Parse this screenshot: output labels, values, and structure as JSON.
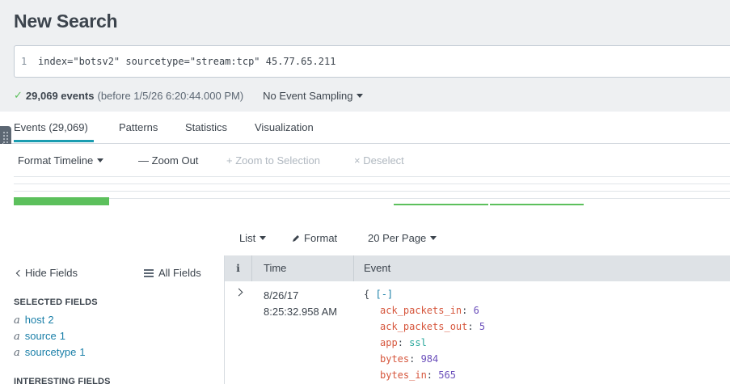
{
  "page": {
    "title": "New Search"
  },
  "search": {
    "line_number": "1",
    "query": "index=\"botsv2\" sourcetype=\"stream:tcp\" 45.77.65.211"
  },
  "status": {
    "check": "✓",
    "count": "29,069 events",
    "detail": "(before 1/5/26 6:20:44.000 PM)",
    "sampling": "No Event Sampling"
  },
  "tabs": [
    {
      "label": "Events (29,069)",
      "active": true
    },
    {
      "label": "Patterns"
    },
    {
      "label": "Statistics"
    },
    {
      "label": "Visualization"
    }
  ],
  "timeline": {
    "format": "Format Timeline",
    "zoom_out": "Zoom Out",
    "zoom_selection": "Zoom to Selection",
    "deselect": "Deselect",
    "zoom_out_glyph": "—",
    "zoom_sel_glyph": "+",
    "deselect_glyph": "×",
    "bar_color": "#5cc05c"
  },
  "results_toolbar": {
    "list": "List",
    "format": "Format",
    "per_page": "20 Per Page"
  },
  "fields": {
    "hide": "Hide Fields",
    "all": "All Fields",
    "selected_title": "SELECTED FIELDS",
    "selected": [
      {
        "type": "a",
        "name": "host",
        "count": "2"
      },
      {
        "type": "a",
        "name": "source",
        "count": "1"
      },
      {
        "type": "a",
        "name": "sourcetype",
        "count": "1"
      }
    ],
    "interesting_title": "INTERESTING FIELDS"
  },
  "table": {
    "col_info": "i",
    "col_time": "Time",
    "col_event": "Event",
    "rows": [
      {
        "date": "8/26/17",
        "time": "8:25:32.958 AM",
        "json_open": "{",
        "json_toggle": "[-]",
        "fields": [
          {
            "key": "ack_packets_in",
            "value": "6",
            "kind": "num"
          },
          {
            "key": "ack_packets_out",
            "value": "5",
            "kind": "num"
          },
          {
            "key": "app",
            "value": "ssl",
            "kind": "str"
          },
          {
            "key": "bytes",
            "value": "984",
            "kind": "num"
          },
          {
            "key": "bytes_in",
            "value": "565",
            "kind": "num"
          }
        ]
      }
    ]
  },
  "colors": {
    "accent": "#1a9cb0",
    "link": "#1a7fa8",
    "json_key": "#d6563c",
    "json_num": "#6b4fbb",
    "json_str": "#26a69a"
  }
}
